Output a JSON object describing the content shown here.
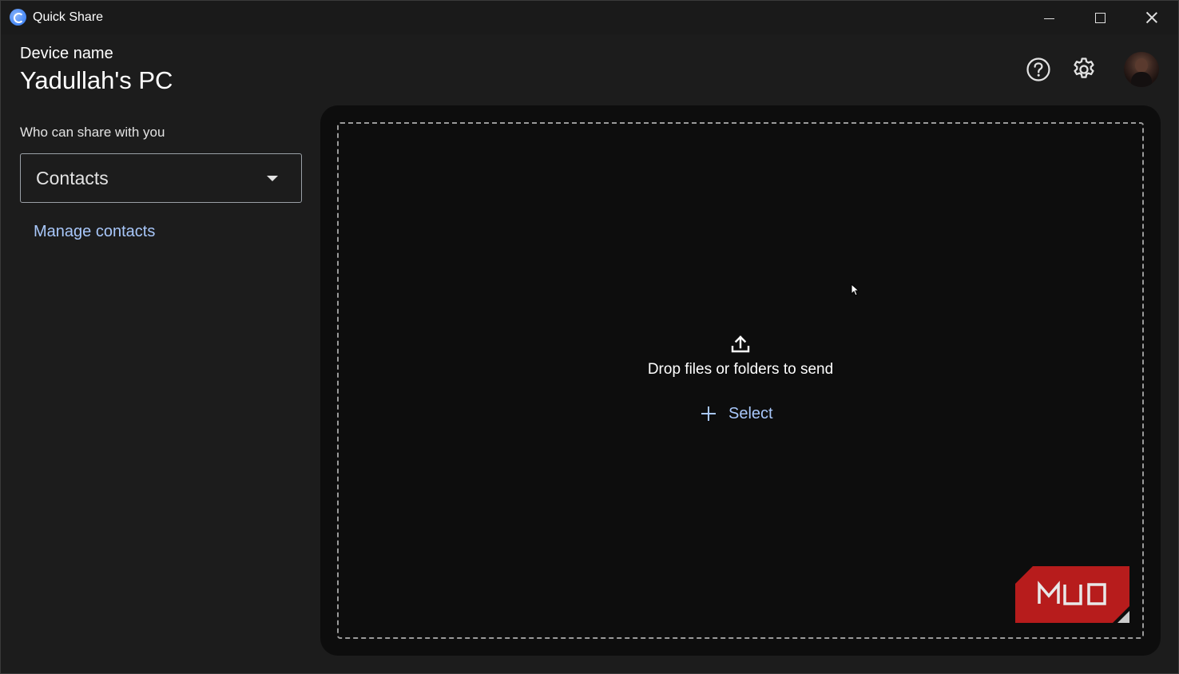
{
  "window": {
    "title": "Quick Share"
  },
  "header": {
    "device_label": "Device name",
    "device_name": "Yadullah's PC"
  },
  "sidebar": {
    "who_label": "Who can share with you",
    "visibility_value": "Contacts",
    "manage_link": "Manage contacts"
  },
  "dropzone": {
    "text": "Drop files or folders to send",
    "select_label": "Select"
  },
  "watermark": {
    "text": "MUO"
  },
  "colors": {
    "accent": "#a8c7fa",
    "background": "#1c1c1c",
    "panel": "#0d0d0d",
    "watermark": "#b71c1c"
  },
  "icons": [
    "quick-share-app-icon",
    "minimize-icon",
    "maximize-icon",
    "close-icon",
    "help-icon",
    "settings-icon",
    "caret-down-icon",
    "upload-icon",
    "plus-icon",
    "cursor-icon"
  ]
}
